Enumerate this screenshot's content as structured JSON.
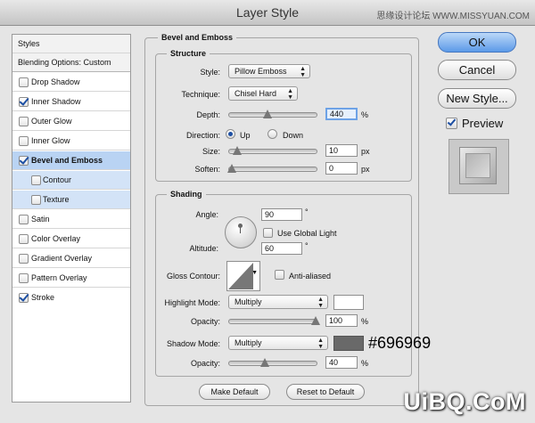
{
  "window": {
    "title": "Layer Style"
  },
  "watermarks": {
    "top": "思缘设计论坛 WWW.MISSYUAN.COM",
    "bottom": "UiBQ.CoM"
  },
  "styles_panel": {
    "header": "Styles",
    "blending": "Blending Options: Custom",
    "items": [
      {
        "label": "Drop Shadow",
        "checked": false
      },
      {
        "label": "Inner Shadow",
        "checked": true
      },
      {
        "label": "Outer Glow",
        "checked": false
      },
      {
        "label": "Inner Glow",
        "checked": false
      },
      {
        "label": "Bevel and Emboss",
        "checked": true
      },
      {
        "label": "Contour",
        "checked": false
      },
      {
        "label": "Texture",
        "checked": false
      },
      {
        "label": "Satin",
        "checked": false
      },
      {
        "label": "Color Overlay",
        "checked": false
      },
      {
        "label": "Gradient Overlay",
        "checked": false
      },
      {
        "label": "Pattern Overlay",
        "checked": false
      },
      {
        "label": "Stroke",
        "checked": true
      }
    ]
  },
  "bevel": {
    "title": "Bevel and Emboss",
    "structure": {
      "title": "Structure",
      "style_label": "Style:",
      "style_value": "Pillow Emboss",
      "technique_label": "Technique:",
      "technique_value": "Chisel Hard",
      "depth_label": "Depth:",
      "depth_value": "440",
      "depth_unit": "%",
      "direction_label": "Direction:",
      "up_label": "Up",
      "down_label": "Down",
      "size_label": "Size:",
      "size_value": "10",
      "size_unit": "px",
      "soften_label": "Soften:",
      "soften_value": "0",
      "soften_unit": "px"
    },
    "shading": {
      "title": "Shading",
      "angle_label": "Angle:",
      "angle_value": "90",
      "angle_unit": "°",
      "global_light_label": "Use Global Light",
      "altitude_label": "Altitude:",
      "altitude_value": "60",
      "altitude_unit": "°",
      "gloss_label": "Gloss Contour:",
      "anti_aliased_label": "Anti-aliased",
      "highlight_mode_label": "Highlight Mode:",
      "highlight_mode_value": "Multiply",
      "highlight_opacity_label": "Opacity:",
      "highlight_opacity_value": "100",
      "highlight_opacity_unit": "%",
      "shadow_mode_label": "Shadow Mode:",
      "shadow_mode_value": "Multiply",
      "shadow_color_annotation": "#696969",
      "shadow_opacity_label": "Opacity:",
      "shadow_opacity_value": "40",
      "shadow_opacity_unit": "%"
    },
    "make_default": "Make Default",
    "reset_default": "Reset to Default"
  },
  "actions": {
    "ok": "OK",
    "cancel": "Cancel",
    "new_style": "New Style...",
    "preview": "Preview"
  },
  "colors": {
    "highlight": "#ffffff",
    "shadow": "#696969",
    "accent": "#5c9ae8"
  }
}
